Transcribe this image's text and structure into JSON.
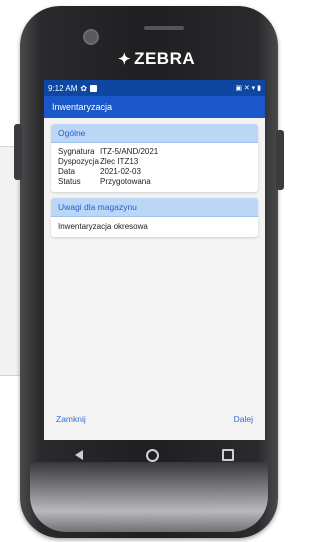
{
  "device": {
    "brand": "ZEBRA"
  },
  "status_bar": {
    "time": "9:12 AM",
    "icons_right": "▣ ✕ ▾ ▮"
  },
  "app_bar": {
    "title": "Inwentaryzacja"
  },
  "general": {
    "header": "Ogólne",
    "rows": [
      {
        "label": "Sygnatura",
        "value": "ITZ-5/AND/2021"
      },
      {
        "label": "Dyspozycja",
        "value": "Zlec ITZ13"
      },
      {
        "label": "Data",
        "value": "2021-02-03"
      },
      {
        "label": "Status",
        "value": "Przygotowana"
      }
    ]
  },
  "notes": {
    "header": "Uwagi dla magazynu",
    "text": "Inwentaryzacja okresowa"
  },
  "footer": {
    "close_label": "Zamknij",
    "next_label": "Dalej"
  },
  "nav_icons": [
    "back-icon",
    "home-icon",
    "recent-apps-icon"
  ]
}
